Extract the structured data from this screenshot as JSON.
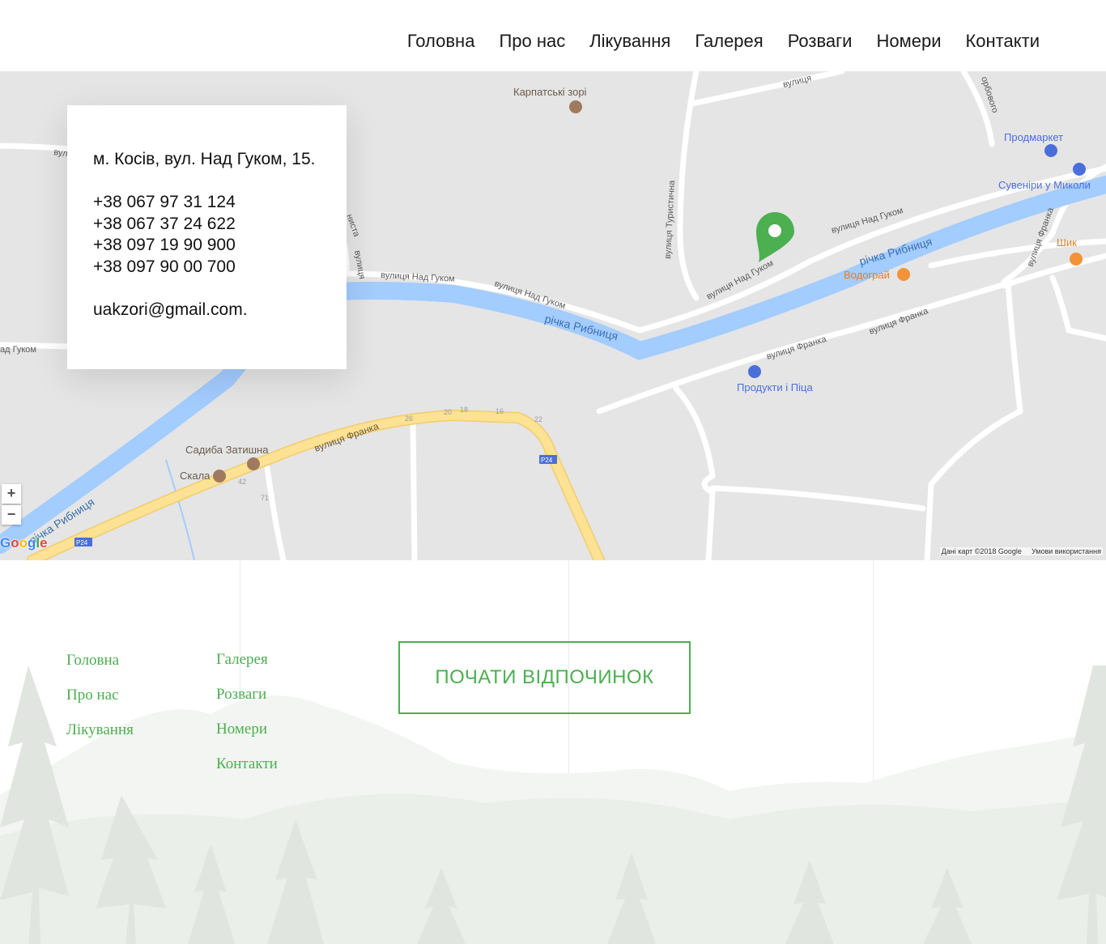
{
  "nav": {
    "items": [
      {
        "label": "Головна"
      },
      {
        "label": "Про нас"
      },
      {
        "label": "Лікування"
      },
      {
        "label": "Галерея"
      },
      {
        "label": "Розваги"
      },
      {
        "label": "Номери"
      },
      {
        "label": "Контакти"
      }
    ]
  },
  "contact": {
    "address": "м. Косів, вул. Над Гуком, 15.",
    "phones": [
      "+38 067 97 31 124",
      "+38 067 37 24 622",
      "+38 097 19 90 900",
      "+38 097 90 00 700"
    ],
    "email": "uakzori@gmail.com."
  },
  "map": {
    "labels": {
      "karpatski_zori": "Карпатські зорі",
      "prodmarket": "Продмаркет",
      "suveniry": "Сувеніри у Миколи",
      "shyk": "Шик",
      "vodohrai": "Водограй",
      "produkty": "Продукти і Піца",
      "sadyba": "Садиба Затишна",
      "skala": "Скала",
      "river_1": "річка Рибниця",
      "river_2": "річка Рибниця",
      "river_3": "річка Рибниця",
      "street_nad_hukom_1": "вулиця Над Гуком",
      "street_nad_hukom_2": "вулиця Над Гуком",
      "street_nad_hukom_3": "вулиця Над Гуком",
      "street_nad_hukom_4": "вулиця Над Гуком",
      "street_nad_hukom_5": "ад Гуком",
      "street_franka_1": "вулиця Франка",
      "street_franka_2": "вулиця Франка",
      "street_franka_3": "вулиця Франка",
      "street_turystychna": "вулиця Туристична",
      "street_top": "вулиця",
      "street_hrabovoho": "орбового",
      "street_franka_v": "вулиця Франка",
      "street_partial_left": "вул",
      "street_partial_mid": "вулиця",
      "street_partial_mid2": "ниста",
      "road_p24_a": "P24",
      "road_p24_b": "P24",
      "num_26": "26",
      "num_20": "20",
      "num_18": "18",
      "num_16": "16",
      "num_22": "22",
      "num_42": "42",
      "num_71": "71"
    },
    "zoom_in": "+",
    "zoom_out": "−",
    "google": {
      "g": "G",
      "o1": "o",
      "o2": "o",
      "g2": "g",
      "l": "l",
      "e": "e"
    },
    "footer_data": "Дані карт ©2018 Google",
    "footer_terms": "Умови використання"
  },
  "footer": {
    "col1": [
      {
        "label": "Головна"
      },
      {
        "label": "Про нас"
      },
      {
        "label": "Лікування"
      }
    ],
    "col2": [
      {
        "label": "Галерея"
      },
      {
        "label": "Розваги"
      },
      {
        "label": "Номери"
      },
      {
        "label": "Контакти"
      }
    ],
    "cta": "ПОЧАТИ ВІДПОЧИНОК"
  },
  "colors": {
    "accent": "#4caf50",
    "map_bg": "#e5e5e5",
    "river": "#a3ccff",
    "highway": "#fde293",
    "poi_orange": "#f29337",
    "poi_blue": "#4a6fdb"
  }
}
